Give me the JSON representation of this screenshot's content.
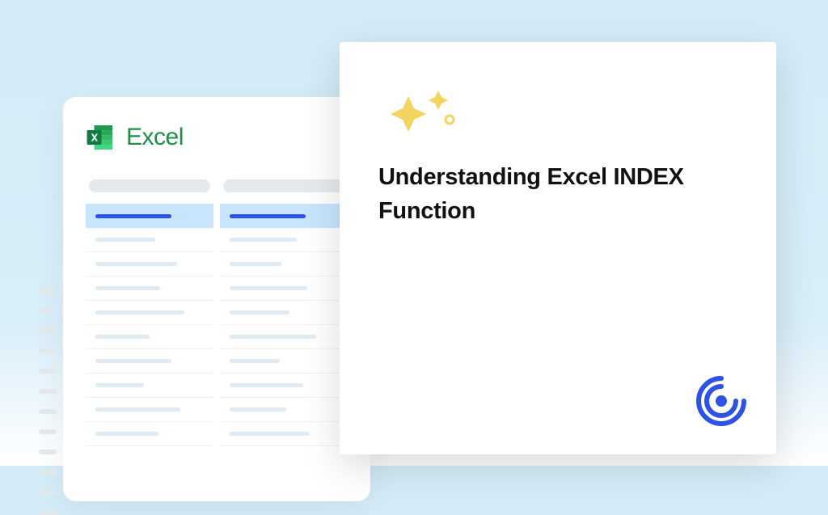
{
  "excel": {
    "label": "Excel",
    "icon_name": "excel-icon"
  },
  "title_card": {
    "heading": "Understanding Excel INDEX Function"
  },
  "colors": {
    "excel_green": "#1d8f46",
    "header_cell": "#c7e5ff",
    "header_line": "#2e52e6",
    "brand_blue": "#2e52e6",
    "sparkle": "#f3d460"
  }
}
